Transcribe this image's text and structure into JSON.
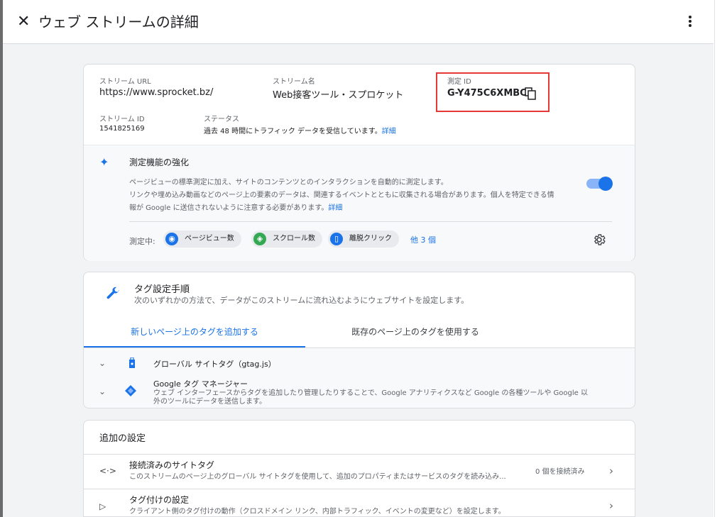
{
  "header": {
    "close_glyph": "✕",
    "title": "ウェブ ストリームの詳細"
  },
  "stream": {
    "url_label": "ストリーム URL",
    "url_value": "https://www.sprocket.bz/",
    "name_label": "ストリーム名",
    "name_value": "Web接客ツール・スプロケット",
    "measurement_id_label": "測定 ID",
    "measurement_id_value": "G-Y475C6XMBC",
    "id_label": "ストリーム ID",
    "id_value": "1541825169",
    "status_label": "ステータス",
    "status_text": "過去 48 時間にトラフィック データを受信しています。",
    "status_link": "詳細"
  },
  "enhanced": {
    "title": "測定機能の強化",
    "desc_line1": "ページビューの標準測定に加え、サイトのコンテンツとのインタラクションを自動的に測定します。",
    "desc_line2": "リンクや埋め込み動画などのページ上の要素のデータは、関連するイベントとともに収集される場合があります。個人を特定できる情",
    "desc_line3": "報が Google に送信されないように注意する必要があります。",
    "desc_link": "詳細",
    "toggle_on": true,
    "measuring_label": "測定中:",
    "chips": [
      {
        "label": "ページビュー数",
        "icon": "eye-icon",
        "color": "#1a73e8"
      },
      {
        "label": "スクロール数",
        "icon": "scroll-icon",
        "color": "#34a853"
      },
      {
        "label": "離脱クリック",
        "icon": "mouse-icon",
        "color": "#1a73e8"
      }
    ],
    "more_label": "他 3 個"
  },
  "tagging": {
    "title": "タグ設定手順",
    "description": "次のいずれかの方法で、データがこのストリームに流れ込むようにウェブサイトを設定します。",
    "tabs": [
      {
        "label": "新しいページ上のタグを追加する",
        "active": true
      },
      {
        "label": "既存のページ上のタグを使用する",
        "active": false
      }
    ],
    "items": [
      {
        "title": "グローバル サイトタグ（gtag.js）"
      },
      {
        "title": "Google タグ マネージャー",
        "description_line1": "ウェブ インターフェースからタグを追加したり管理したりすることで、Google アナリティクスなど Google の各種ツールや Google 以",
        "description_line2": "外のツールにデータを送信します。"
      }
    ]
  },
  "additional": {
    "title": "追加の設定",
    "rows": [
      {
        "icon_glyph": "<·>",
        "title": "接続済みのサイトタグ",
        "description": "このストリームのページ上のグローバル サイトタグを使用して、追加のプロパティまたはサービスのタグを読み込み...",
        "status": "0 個を接続済み"
      },
      {
        "icon_glyph": "▷",
        "title": "タグ付けの設定",
        "description": "クライアント側のタグ付けの動作（クロスドメイン リンク、内部トラフィック、イベントの変更など）を設定します。",
        "status": ""
      }
    ]
  },
  "colors": {
    "accent": "#1a73e8",
    "highlight_box": "#e53935",
    "panel_bg": "#f1f3f4"
  }
}
